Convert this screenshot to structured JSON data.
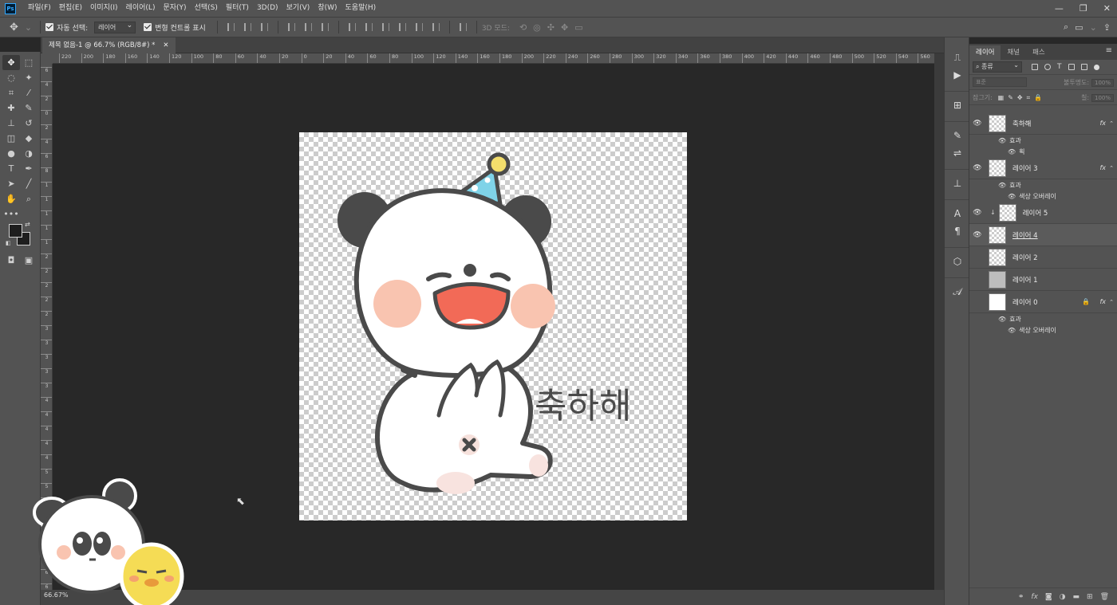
{
  "menubar": {
    "logo": "Ps",
    "items": [
      "파일(F)",
      "편집(E)",
      "이미지(I)",
      "레이어(L)",
      "문자(Y)",
      "선택(S)",
      "필터(T)",
      "3D(D)",
      "보기(V)",
      "창(W)",
      "도움말(H)"
    ]
  },
  "options": {
    "auto_select_label": "자동 선택:",
    "auto_select_value": "레이어",
    "transform_label": "변형 컨트롤 표시",
    "mode_3d_label": "3D 모드:"
  },
  "document": {
    "tab_title": "제목 없음-1 @ 66.7% (RGB/8#) *",
    "zoom": "66.67%"
  },
  "ruler_h": [
    "220",
    "200",
    "180",
    "160",
    "140",
    "120",
    "100",
    "80",
    "60",
    "40",
    "20",
    "0",
    "20",
    "40",
    "60",
    "80",
    "100",
    "120",
    "140",
    "160",
    "180",
    "200",
    "220",
    "240",
    "260",
    "280",
    "300",
    "320",
    "340",
    "360",
    "380",
    "400",
    "420",
    "440",
    "460",
    "480",
    "500",
    "520",
    "540",
    "560"
  ],
  "ruler_v": [
    "6",
    "4",
    "2",
    "0",
    "2",
    "4",
    "6",
    "8",
    "1",
    "1",
    "1",
    "1",
    "1",
    "2",
    "2",
    "2",
    "2",
    "2",
    "3",
    "3",
    "3",
    "3",
    "3",
    "4",
    "4",
    "4",
    "4",
    "4",
    "5",
    "5",
    "5",
    "5",
    "5",
    "6",
    "6",
    "6",
    "6"
  ],
  "canvas_art": {
    "text": "축하해",
    "colors": {
      "outline": "#4a4a4a",
      "cheek": "#f9c4b0",
      "mouth": "#f26a57",
      "hat": "#7fd3e8",
      "pompom": "#f3de6c"
    }
  },
  "layers_panel": {
    "tabs": [
      "레이어",
      "채널",
      "패스"
    ],
    "filter_label": "종류",
    "blend_mode": "표준",
    "opacity_label": "불투명도:",
    "opacity_value": "100%",
    "lock_label": "잠그기:",
    "fill_label": "칠:",
    "fill_value": "100%",
    "layers": [
      {
        "name": "축하해",
        "visible": true,
        "fx": "fx",
        "effects_label": "효과",
        "effects": [
          "획"
        ]
      },
      {
        "name": "레이어 3",
        "visible": true,
        "fx": "fx",
        "effects_label": "효과",
        "effects": [
          "색상 오버레이"
        ]
      },
      {
        "name": "레이어 5",
        "visible": true
      },
      {
        "name": "레이어 4",
        "visible": true
      },
      {
        "name": "레이어 2",
        "visible": false
      },
      {
        "name": "레이어 1",
        "visible": false
      },
      {
        "name": "레이어 0",
        "visible": false,
        "fx": "fx",
        "effects_label": "효과",
        "effects": [
          "색상 오버레이"
        ]
      }
    ]
  }
}
